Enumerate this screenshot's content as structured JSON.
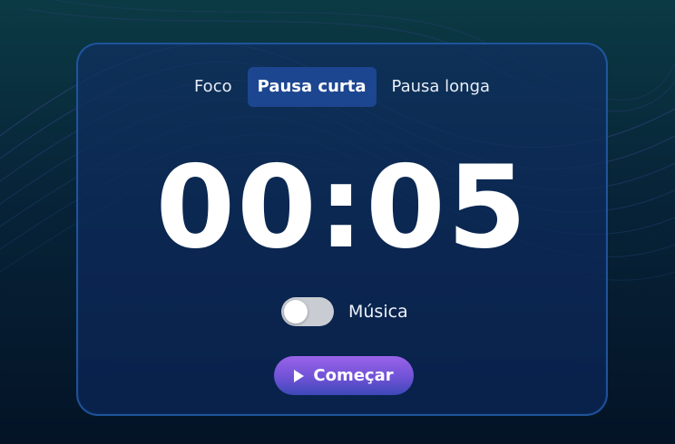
{
  "tabs": [
    {
      "label": "Foco",
      "active": false
    },
    {
      "label": "Pausa curta",
      "active": true
    },
    {
      "label": "Pausa longa",
      "active": false
    }
  ],
  "timer": {
    "display": "00:05"
  },
  "music": {
    "label": "Música",
    "enabled": false
  },
  "start_button": {
    "label": "Começar",
    "icon": "play-icon"
  },
  "colors": {
    "background_top": "#0b3a44",
    "background_bottom": "#041326",
    "card_border": "#2563b4",
    "active_tab": "#1d4690",
    "button_gradient_start": "#9a63e8",
    "button_gradient_end": "#3d48b8",
    "toggle_off": "#c9ccd2"
  }
}
